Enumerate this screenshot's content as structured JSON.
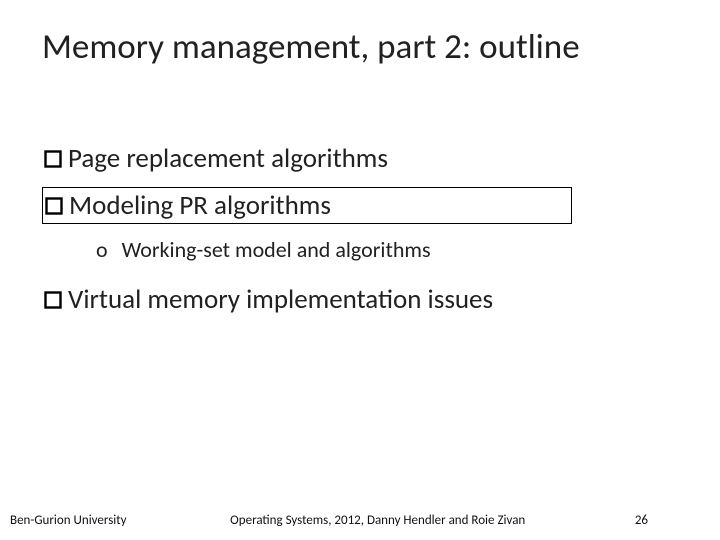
{
  "title": "Memory management, part 2: outline",
  "bullets": {
    "b1": "Page replacement algorithms",
    "b2": "Modeling PR algorithms",
    "b2_sub": "Working-set model and algorithms",
    "b3": "Virtual memory implementation issues"
  },
  "footer": {
    "left": "Ben-Gurion University",
    "center": "Operating Systems, 2012, Danny Hendler and Roie Zivan",
    "page": "26"
  },
  "sub_marker": "o"
}
